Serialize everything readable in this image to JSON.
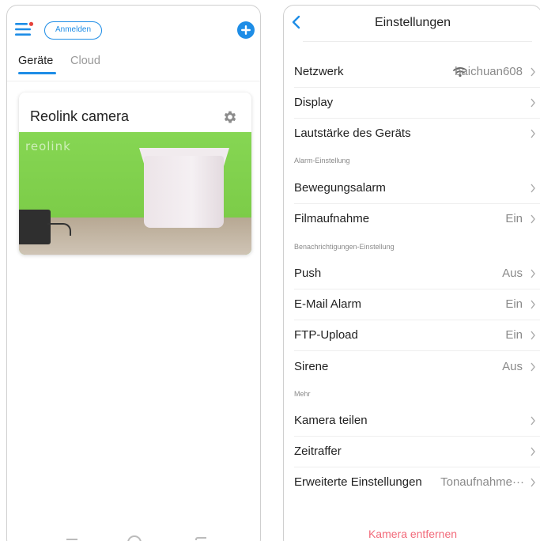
{
  "left": {
    "login_label": "Anmelden",
    "tabs": [
      {
        "label": "Geräte",
        "active": true
      },
      {
        "label": "Cloud",
        "active": false
      }
    ],
    "device_card": {
      "name": "Reolink camera",
      "preview_logo": "reolink"
    },
    "icons": {
      "menu": "menu-icon",
      "add": "plus-circle-icon",
      "settings": "gear-icon"
    },
    "colors": {
      "accent": "#1e8de6",
      "notification_dot": "#e5433b"
    }
  },
  "right": {
    "title": "Einstellungen",
    "rows": [
      {
        "key": "netzwerk",
        "label": "Netzwerk",
        "value": "baichuan608",
        "icon": "wifi-icon"
      },
      {
        "key": "display",
        "label": "Display",
        "value": ""
      },
      {
        "key": "lautstaerke",
        "label": "Lautstärke des Geräts",
        "value": ""
      }
    ],
    "section_alarm": "Alarm-Einstellung",
    "rows_alarm": [
      {
        "key": "bewegungsalarm",
        "label": "Bewegungsalarm",
        "value": ""
      },
      {
        "key": "filmaufnahme",
        "label": "Filmaufnahme",
        "value": "Ein"
      }
    ],
    "section_notify": "Benachrichtigungen-Einstellung",
    "rows_notify": [
      {
        "key": "push",
        "label": "Push",
        "value": "Aus"
      },
      {
        "key": "email",
        "label": "E-Mail Alarm",
        "value": "Ein"
      },
      {
        "key": "ftp",
        "label": "FTP-Upload",
        "value": "Ein"
      },
      {
        "key": "sirene",
        "label": "Sirene",
        "value": "Aus"
      }
    ],
    "section_more": "Mehr",
    "rows_more": [
      {
        "key": "teilen",
        "label": "Kamera teilen",
        "value": ""
      },
      {
        "key": "zeitraffer",
        "label": "Zeitraffer",
        "value": ""
      },
      {
        "key": "erweitert",
        "label": "Erweiterte Einstellungen",
        "value": "Tonaufnahme···"
      }
    ],
    "remove_label": "Kamera entfernen",
    "colors": {
      "danger": "#f26a7a",
      "muted": "#8a8a8a"
    }
  }
}
